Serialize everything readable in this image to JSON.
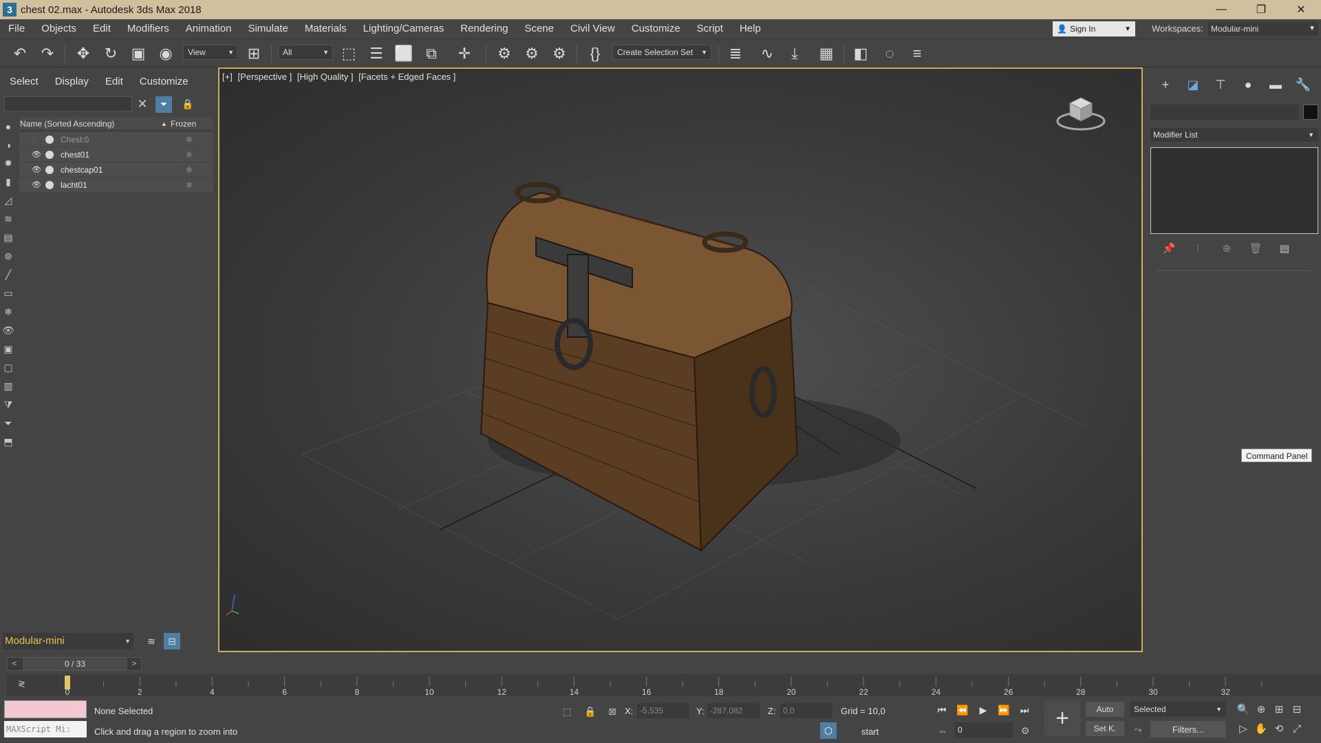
{
  "titlebar": {
    "app_icon": "3",
    "title": "chest 02.max - Autodesk 3ds Max 2018",
    "minimize": "—",
    "restore": "❐",
    "close": "✕"
  },
  "menu": {
    "items": [
      "File",
      "Objects",
      "Edit",
      "Modifiers",
      "Animation",
      "Simulate",
      "Materials",
      "Lighting/Cameras",
      "Rendering",
      "Scene",
      "Civil View",
      "Customize",
      "Script",
      "Help"
    ],
    "signin_label": "Sign In",
    "workspaces_label": "Workspaces:",
    "workspace_value": "Modular-mini"
  },
  "toolbar": {
    "reference_coord": "View",
    "selection_filter": "All",
    "named_selection": "Create Selection Set"
  },
  "explorer": {
    "tabs": [
      "Select",
      "Display",
      "Edit",
      "Customize"
    ],
    "column_name": "Name (Sorted Ascending)",
    "sort_arrow": "▲",
    "column_frozen": "Frozen",
    "rows": [
      {
        "name": "Chest:0",
        "visible": false
      },
      {
        "name": "chest01",
        "visible": true
      },
      {
        "name": "chestcap01",
        "visible": true
      },
      {
        "name": "lacht01",
        "visible": true
      }
    ],
    "workspace_bottom": "Modular-mini"
  },
  "viewport": {
    "labels": [
      "[+]",
      "[Perspective ]",
      "[High Quality ]",
      "[Facets + Edged Faces ]"
    ]
  },
  "command_panel": {
    "modifier_list": "Modifier List",
    "tooltip": "Command Panel"
  },
  "timeline": {
    "slider_value": "0 / 33",
    "prev": "<",
    "next": ">",
    "ticks": [
      "0",
      "2",
      "4",
      "6",
      "8",
      "10",
      "12",
      "14",
      "16",
      "18",
      "20",
      "22",
      "24",
      "26",
      "28",
      "30",
      "32"
    ]
  },
  "status": {
    "selection": "None Selected",
    "prompt": "Click and drag a region to zoom into",
    "maxscript": "MAXScript Mi:",
    "x_label": "X:",
    "x_value": "-5,535",
    "y_label": "Y:",
    "y_value": "-287,082",
    "z_label": "Z:",
    "z_value": "0,0",
    "grid": "Grid = 10,0",
    "start": "start",
    "current_frame": "0",
    "auto_key": "Auto",
    "set_key": "Set K.",
    "key_filter": "Selected",
    "filters": "Filters..."
  }
}
